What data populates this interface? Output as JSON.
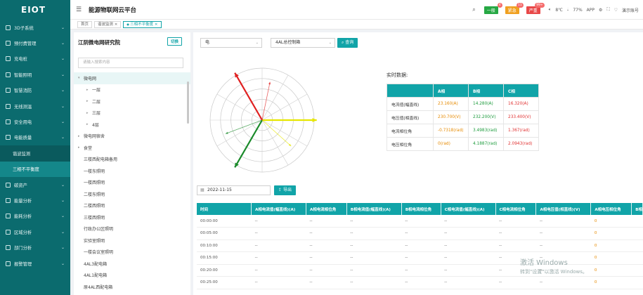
{
  "app": {
    "logo": "EIOT",
    "title": "能源物联网云平台"
  },
  "header": {
    "alerts": [
      {
        "label": "一般",
        "count": "4",
        "color": "#27a844"
      },
      {
        "label": "紧急",
        "count": "11",
        "color": "#f0a020"
      },
      {
        "label": "严重",
        "count": "99+",
        "color": "#e84848"
      }
    ],
    "temperature": "8℃",
    "humidity": "77%",
    "app_label": "APP",
    "user": "演示账号"
  },
  "sidebar": {
    "items": [
      {
        "label": "3D子系统"
      },
      {
        "label": "预付费管理"
      },
      {
        "label": "充电桩"
      },
      {
        "label": "智能照明"
      },
      {
        "label": "智慧消防"
      },
      {
        "label": "无线测温"
      },
      {
        "label": "安全用电"
      },
      {
        "label": "电能质量"
      }
    ],
    "subitems": [
      {
        "label": "谐波监测"
      },
      {
        "label": "三相不平衡度"
      }
    ],
    "items_after": [
      {
        "label": "碳资产"
      },
      {
        "label": "能量分析"
      },
      {
        "label": "能耗分析"
      },
      {
        "label": "区域分析"
      },
      {
        "label": "部门分析"
      },
      {
        "label": "报警管理"
      }
    ]
  },
  "tabs": [
    {
      "label": "首页"
    },
    {
      "label": "谐波监测"
    },
    {
      "label": "三相不平衡度"
    }
  ],
  "tree": {
    "title": "江阴微电网研究院",
    "switch_label": "切换",
    "search_placeholder": "请输入搜索内容",
    "nodes": [
      {
        "label": "微电网",
        "level": 0,
        "arrow": "▾",
        "selected": true
      },
      {
        "label": "一层",
        "level": 1,
        "arrow": "▸"
      },
      {
        "label": "二层",
        "level": 1,
        "arrow": "▸"
      },
      {
        "label": "三层",
        "level": 1,
        "arrow": "▸"
      },
      {
        "label": "4层",
        "level": 1,
        "arrow": "▸"
      },
      {
        "label": "微电网宿舍",
        "level": 0,
        "arrow": "▸"
      },
      {
        "label": "食堂",
        "level": 0,
        "arrow": "▸"
      },
      {
        "label": "三楼西配电箱备用",
        "level": 0,
        "arrow": ""
      },
      {
        "label": "一楼东照明",
        "level": 0,
        "arrow": ""
      },
      {
        "label": "一楼西照明",
        "level": 0,
        "arrow": ""
      },
      {
        "label": "二楼东照明",
        "level": 0,
        "arrow": ""
      },
      {
        "label": "二楼西照明",
        "level": 0,
        "arrow": ""
      },
      {
        "label": "三楼西照明",
        "level": 0,
        "arrow": ""
      },
      {
        "label": "行政办公区照明",
        "level": 0,
        "arrow": ""
      },
      {
        "label": "实验室照明",
        "level": 0,
        "arrow": ""
      },
      {
        "label": "一楼会议室照明",
        "level": 0,
        "arrow": ""
      },
      {
        "label": "4AL3配电箱",
        "level": 0,
        "arrow": ""
      },
      {
        "label": "4AL1配电箱",
        "level": 0,
        "arrow": ""
      },
      {
        "label": "原4AL西配电箱",
        "level": 0,
        "arrow": ""
      }
    ]
  },
  "controls": {
    "type_select": "电",
    "device_select": "4AL总控制箱",
    "query_label": "查询",
    "date": "2022-11-15",
    "export_label": "导出"
  },
  "realtime": {
    "label": "实时数据:",
    "headers": [
      "",
      "A相",
      "B相",
      "C相"
    ],
    "rows": [
      {
        "name": "电流值(幅直线)",
        "a": "23.160(A)",
        "b": "14.280(A)",
        "c": "16.320(A)"
      },
      {
        "name": "电压值(相直线)",
        "a": "230.700(V)",
        "b": "232.200(V)",
        "c": "233.400(V)"
      },
      {
        "name": "电流相位角",
        "a": "-0.7318(rad)",
        "b": "3.4983(rad)",
        "c": "1.367(rad)"
      },
      {
        "name": "电压相位角",
        "a": "0(rad)",
        "b": "4.1887(rad)",
        "c": "2.0943(rad)"
      }
    ]
  },
  "phasor": {
    "colors": {
      "a": "#e6e600",
      "b": "#1a8a2a",
      "c": "#e02020"
    },
    "voltage": [
      {
        "phase": "a",
        "angle_rad": 0,
        "magnitude": 230.7
      },
      {
        "phase": "b",
        "angle_rad": 4.1887,
        "magnitude": 232.2
      },
      {
        "phase": "c",
        "angle_rad": 2.0943,
        "magnitude": 233.4
      }
    ],
    "current": [
      {
        "phase": "a",
        "angle_rad": -0.7318,
        "magnitude": 23.16
      },
      {
        "phase": "b",
        "angle_rad": 3.4983,
        "magnitude": 14.28
      },
      {
        "phase": "c",
        "angle_rad": 1.367,
        "magnitude": 16.32
      }
    ]
  },
  "history": {
    "headers": [
      "时间",
      "A相电流值(幅直线)(A)",
      "A相电流相位角",
      "B相电流值(幅直线)(A)",
      "B相电流相位角",
      "C相电流值(幅直线)(A)",
      "C相电流相位角",
      "A相电压值(相直线)(V)",
      "A相电压相位角",
      "B相"
    ],
    "rows": [
      {
        "time": "00:00:00",
        "cells": [
          "--",
          "--",
          "--",
          "--",
          "--",
          "--",
          "--",
          "0"
        ]
      },
      {
        "time": "00:05:00",
        "cells": [
          "--",
          "--",
          "--",
          "--",
          "--",
          "--",
          "--",
          "0"
        ]
      },
      {
        "time": "00:10:00",
        "cells": [
          "--",
          "--",
          "--",
          "--",
          "--",
          "--",
          "--",
          "0"
        ]
      },
      {
        "time": "00:15:00",
        "cells": [
          "--",
          "--",
          "--",
          "--",
          "--",
          "--",
          "--",
          "0"
        ]
      },
      {
        "time": "00:20:00",
        "cells": [
          "--",
          "--",
          "--",
          "--",
          "--",
          "--",
          "--",
          "0"
        ]
      },
      {
        "time": "00:25:00",
        "cells": [
          "--",
          "--",
          "--",
          "--",
          "--",
          "--",
          "--",
          "0"
        ]
      }
    ]
  },
  "watermark": {
    "line1": "激活 Windows",
    "line2": "转到\"设置\"以激活 Windows。"
  }
}
